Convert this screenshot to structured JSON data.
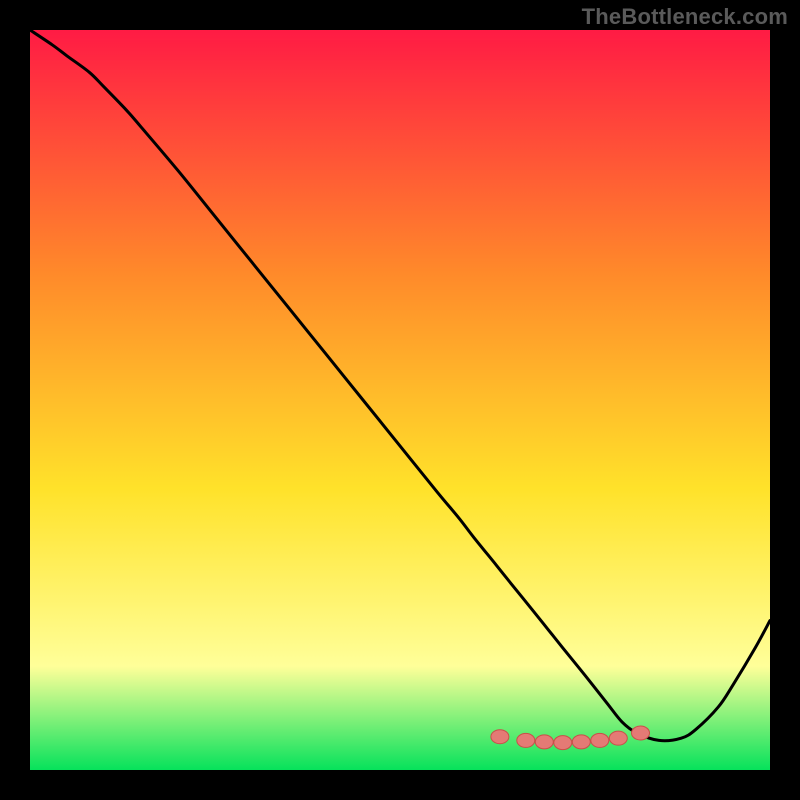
{
  "watermark": "TheBottleneck.com",
  "colors": {
    "bg": "#000000",
    "grad_top": "#ff1b44",
    "grad_mid1": "#ff8a2a",
    "grad_mid2": "#ffe22a",
    "grad_low": "#ffff99",
    "grad_bottom": "#06e25b",
    "curve": "#000000",
    "marker_fill": "#e47a75",
    "marker_stroke": "#c94f49"
  },
  "chart_data": {
    "type": "line",
    "title": "",
    "xlabel": "",
    "ylabel": "",
    "xlim": [
      0,
      100
    ],
    "ylim": [
      0,
      100
    ],
    "x": [
      0,
      3,
      5,
      8,
      10,
      13,
      15,
      20,
      25,
      30,
      35,
      40,
      45,
      50,
      55,
      58,
      60,
      63,
      65,
      68,
      70,
      72,
      75,
      78,
      80,
      82,
      85,
      88,
      90,
      93,
      95,
      98,
      100
    ],
    "values": [
      100,
      98,
      96.5,
      94.3,
      92.3,
      89.2,
      86.9,
      81,
      74.8,
      68.6,
      62.4,
      56.2,
      50,
      43.8,
      37.6,
      34,
      31.4,
      27.7,
      25.2,
      21.5,
      19,
      16.5,
      12.8,
      9,
      6.5,
      5,
      4,
      4.3,
      5.5,
      8.5,
      11.5,
      16.5,
      20.2
    ],
    "markers_x": [
      63.5,
      67,
      69.5,
      72,
      74.5,
      77,
      79.5,
      82.5
    ],
    "markers_y": [
      4.5,
      4,
      3.8,
      3.7,
      3.8,
      4,
      4.3,
      5
    ],
    "annotations": []
  }
}
